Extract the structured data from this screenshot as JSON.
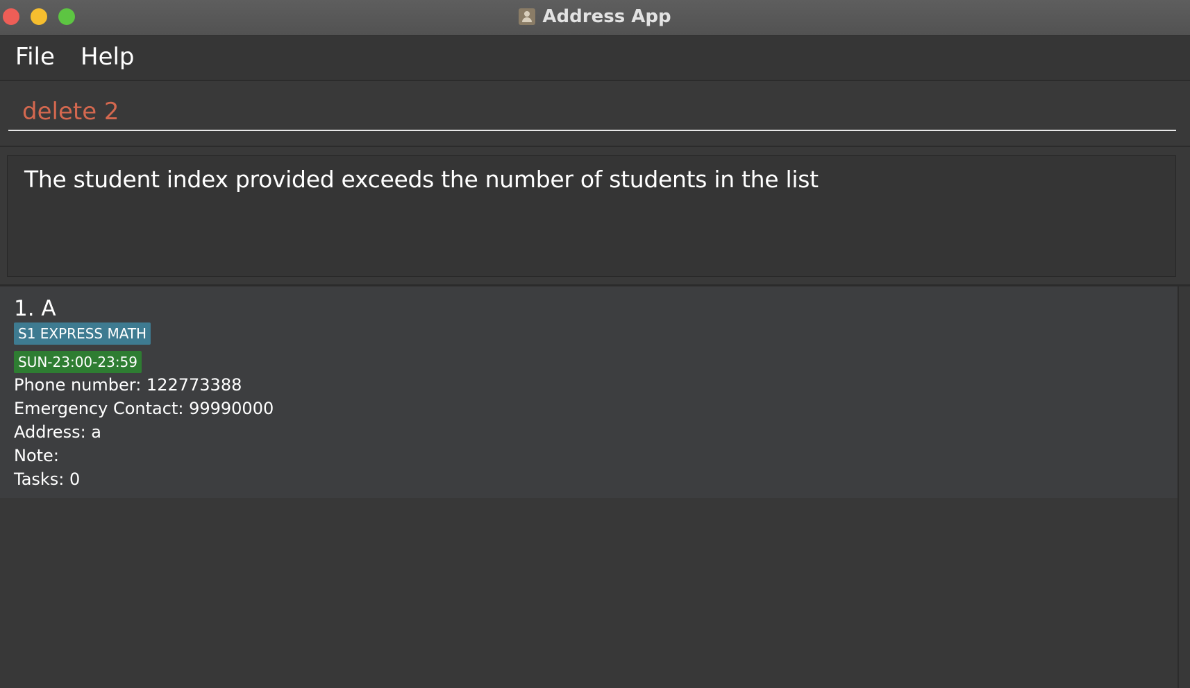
{
  "window": {
    "title": "Address App",
    "controls": [
      "close",
      "minimize",
      "maximize"
    ]
  },
  "menu": {
    "file_label": "File",
    "help_label": "Help"
  },
  "command": {
    "value": "delete 2"
  },
  "result": {
    "message": "The student index provided exceeds the number of students in the list"
  },
  "students": [
    {
      "name": "1. A",
      "subject_tag": "S1 EXPRESS MATH",
      "time_tag": "SUN-23:00-23:59",
      "phone": "Phone number: 122773388",
      "emergency": "Emergency Contact: 99990000",
      "address": "Address: a",
      "note": "Note:",
      "tasks": "Tasks: 0"
    }
  ],
  "colors": {
    "subject_tag": "#3e7b91",
    "time_tag": "#2e7d32",
    "command_text": "#d4684f"
  }
}
